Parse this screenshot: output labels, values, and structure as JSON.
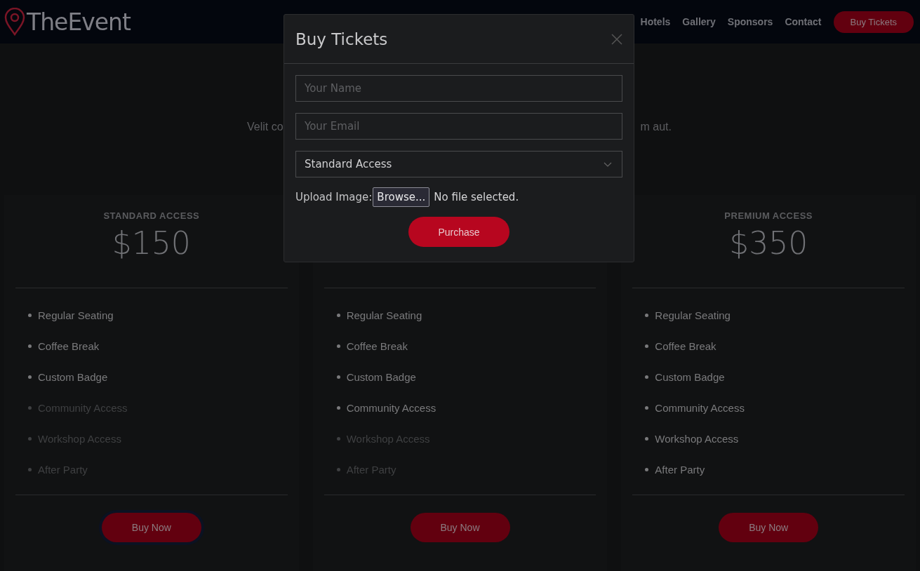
{
  "header": {
    "logo": "TheEvent",
    "nav": [
      {
        "label": "Hotels"
      },
      {
        "label": "Gallery"
      },
      {
        "label": "Sponsors"
      },
      {
        "label": "Contact"
      }
    ],
    "cta": "Buy Tickets"
  },
  "intro": {
    "left": "Velit co",
    "right": "m aut."
  },
  "plans": [
    {
      "title": "STANDARD ACCESS",
      "price": "$150",
      "focused": true,
      "button": "Buy Now",
      "features": [
        {
          "label": "Regular Seating",
          "included": true
        },
        {
          "label": "Coffee Break",
          "included": true
        },
        {
          "label": "Custom Badge",
          "included": true
        },
        {
          "label": "Community Access",
          "included": false
        },
        {
          "label": "Workshop Access",
          "included": false
        },
        {
          "label": "After Party",
          "included": false
        }
      ]
    },
    {
      "focused": false,
      "button": "Buy Now",
      "features": [
        {
          "label": "Regular Seating",
          "included": true
        },
        {
          "label": "Coffee Break",
          "included": true
        },
        {
          "label": "Custom Badge",
          "included": true
        },
        {
          "label": "Community Access",
          "included": true
        },
        {
          "label": "Workshop Access",
          "included": false
        },
        {
          "label": "After Party",
          "included": false
        }
      ]
    },
    {
      "title": "PREMIUM ACCESS",
      "price": "$350",
      "focused": false,
      "button": "Buy Now",
      "features": [
        {
          "label": "Regular Seating",
          "included": true
        },
        {
          "label": "Coffee Break",
          "included": true
        },
        {
          "label": "Custom Badge",
          "included": true
        },
        {
          "label": "Community Access",
          "included": true
        },
        {
          "label": "Workshop Access",
          "included": true
        },
        {
          "label": "After Party",
          "included": true
        }
      ]
    }
  ],
  "modal": {
    "title": "Buy Tickets",
    "name_field": {
      "placeholder": "Your Name"
    },
    "email_field": {
      "placeholder": "Your Email"
    },
    "ticket_select": {
      "value": "Standard Access"
    },
    "upload": {
      "label": "Upload Image:",
      "button": "Browse...",
      "status": "No file selected."
    },
    "submit": "Purchase"
  }
}
